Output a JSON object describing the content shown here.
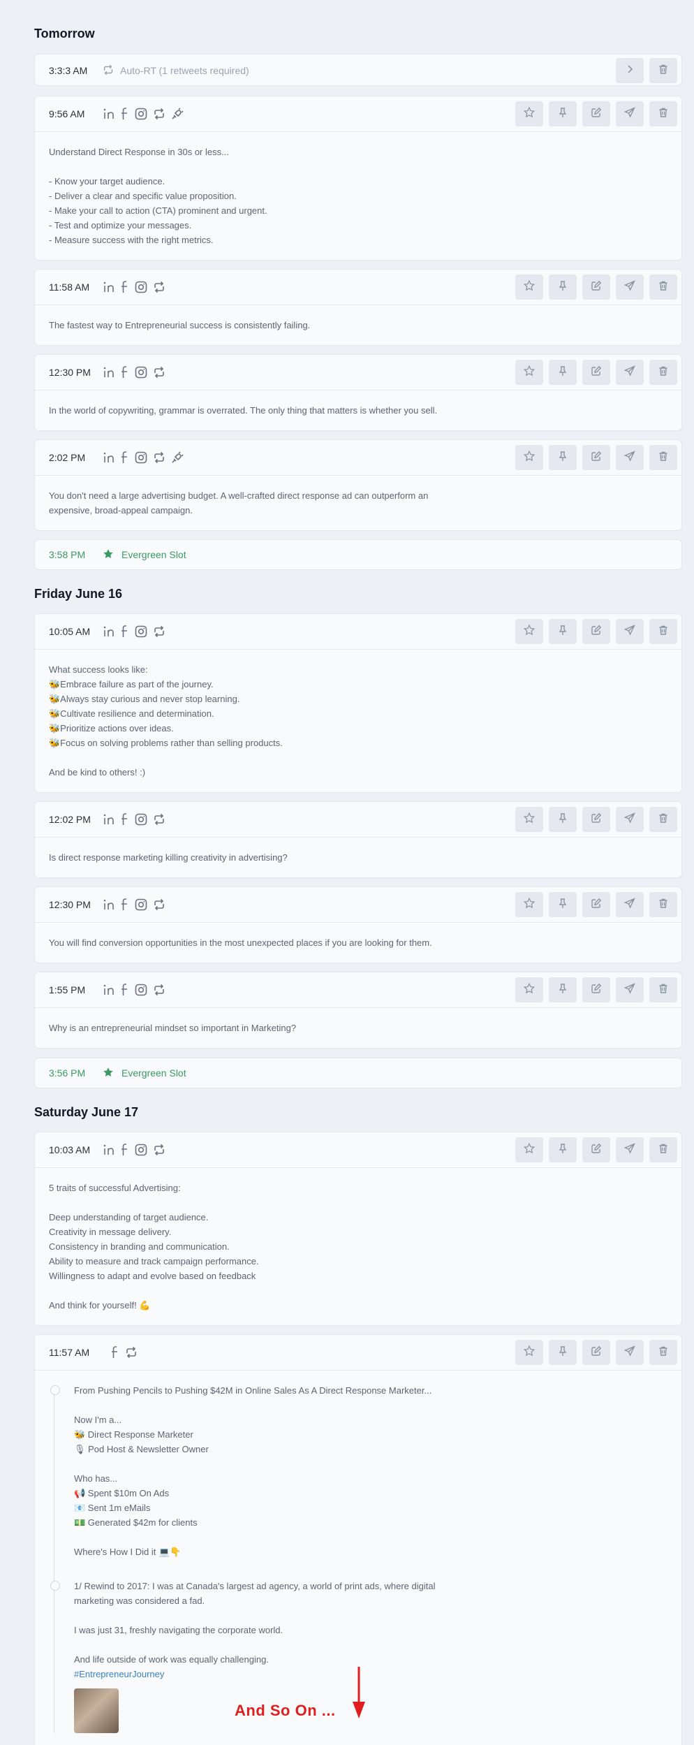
{
  "days": {
    "tomorrow": "Tomorrow",
    "friday": "Friday June 16",
    "saturday": "Saturday June 17"
  },
  "posts": {
    "p1": {
      "time": "3:3:3 AM",
      "autort": "Auto-RT (1 retweets required)"
    },
    "p2": {
      "time": "9:56 AM",
      "body": [
        "Understand Direct Response in 30s or less...",
        "",
        "- Know your target audience.",
        "- Deliver a clear and specific value proposition.",
        "- Make your call to action (CTA) prominent and urgent.",
        "- Test and optimize your messages.",
        " - Measure success with the right metrics."
      ]
    },
    "p3": {
      "time": "11:58 AM",
      "body": [
        "The fastest way to Entrepreneurial success is consistently failing."
      ]
    },
    "p4": {
      "time": "12:30 PM",
      "body": [
        "In the world of copywriting, grammar is overrated. The only thing that matters is whether you sell."
      ]
    },
    "p5": {
      "time": "2:02 PM",
      "body": [
        "You don't need a large advertising budget. A well-crafted direct response ad can outperform an",
        "expensive, broad-appeal campaign."
      ]
    },
    "e1": {
      "time": "3:58 PM",
      "label": "Evergreen Slot"
    },
    "p6": {
      "time": "10:05 AM",
      "body": [
        "What success looks like:",
        "🐝Embrace failure as part of the journey.",
        "🐝Always stay curious and never stop learning.",
        "🐝Cultivate resilience and determination.",
        "🐝Prioritize actions over ideas.",
        "🐝Focus on solving problems rather than selling products.",
        "",
        "And be kind to others! :)"
      ]
    },
    "p7": {
      "time": "12:02 PM",
      "body": [
        "Is direct response marketing killing creativity in advertising?"
      ]
    },
    "p8": {
      "time": "12:30 PM",
      "body": [
        "You will find conversion opportunities in the most unexpected places if you are looking for them."
      ]
    },
    "p9": {
      "time": "1:55 PM",
      "body": [
        "Why is an entrepreneurial mindset so important in Marketing?"
      ]
    },
    "e2": {
      "time": "3:56 PM",
      "label": "Evergreen Slot"
    },
    "p10": {
      "time": "10:03 AM",
      "body": [
        "5 traits of successful Advertising:",
        "",
        "Deep understanding of target audience.",
        "Creativity in message delivery.",
        "Consistency in branding and communication.",
        "Ability to measure and track campaign performance.",
        "Willingness to adapt and evolve based on feedback",
        "",
        "And think for yourself! 💪"
      ]
    },
    "p11": {
      "time": "11:57 AM",
      "thread1": [
        "From Pushing Pencils to Pushing $42M in Online Sales As A Direct Response Marketer...",
        "",
        "Now I'm a...",
        "🐝 Direct Response Marketer",
        "🎙 Pod Host & Newsletter Owner",
        "",
        "Who has...",
        "📢 Spent $10m On Ads",
        "📧 Sent 1m eMails",
        "💵 Generated $42m for clients",
        "",
        "Where's How I Did it 💻👇"
      ],
      "thread2": [
        "1/ Rewind to 2017: I was at Canada's largest ad agency, a world of print ads, where digital",
        "marketing was considered a fad.",
        "",
        "I was just 31, freshly navigating the corporate world.",
        "",
        "And life outside of work was equally challenging."
      ],
      "hashtag": "#EntrepreneurJourney"
    }
  },
  "annotation": "And So On ...",
  "colors": {
    "accent_green": "#3a9a62",
    "annotation_red": "#e11d1d",
    "hashtag_blue": "#3b82c4"
  }
}
